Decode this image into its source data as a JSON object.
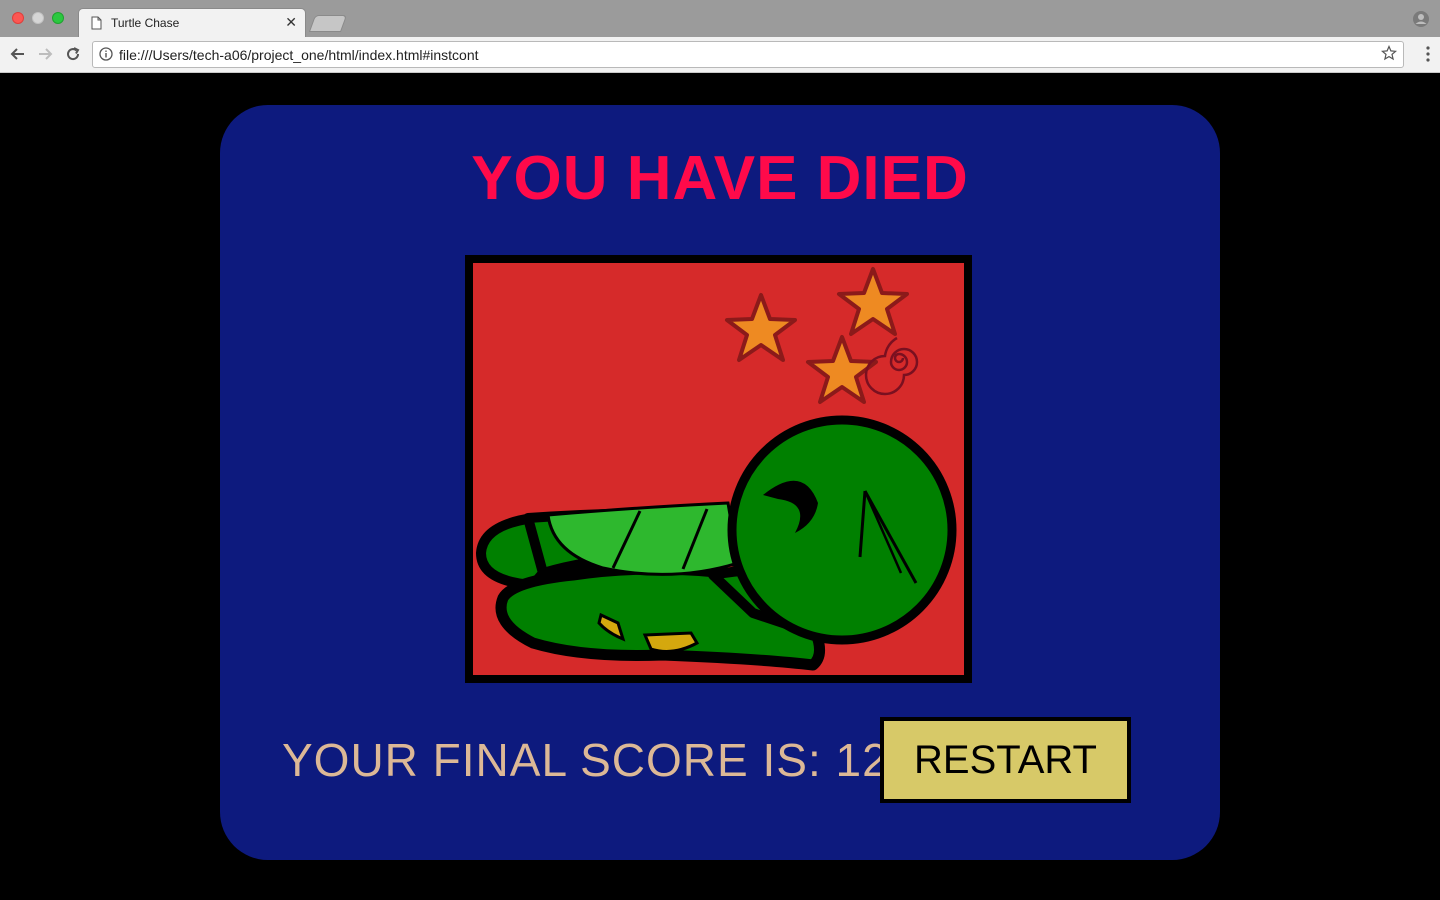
{
  "browser": {
    "tab_title": "Turtle Chase",
    "url": "file:///Users/tech-a06/project_one/html/index.html#instcont"
  },
  "game": {
    "title": "YOU HAVE DIED",
    "score_label": "YOUR FINAL SCORE IS: 12!",
    "final_score": 12,
    "restart_label": "RESTART",
    "colors": {
      "background": "#000000",
      "panel": "#0d1a7e",
      "title": "#ff0a4a",
      "score_text": "#dcb896",
      "restart_button": "#d7c968",
      "art_background": "#d62a2a",
      "turtle_green": "#008000",
      "shell_green": "#2eb82e",
      "star_orange": "#ee8a22"
    },
    "illustration": "dead-turtle-with-dizzy-stars"
  }
}
